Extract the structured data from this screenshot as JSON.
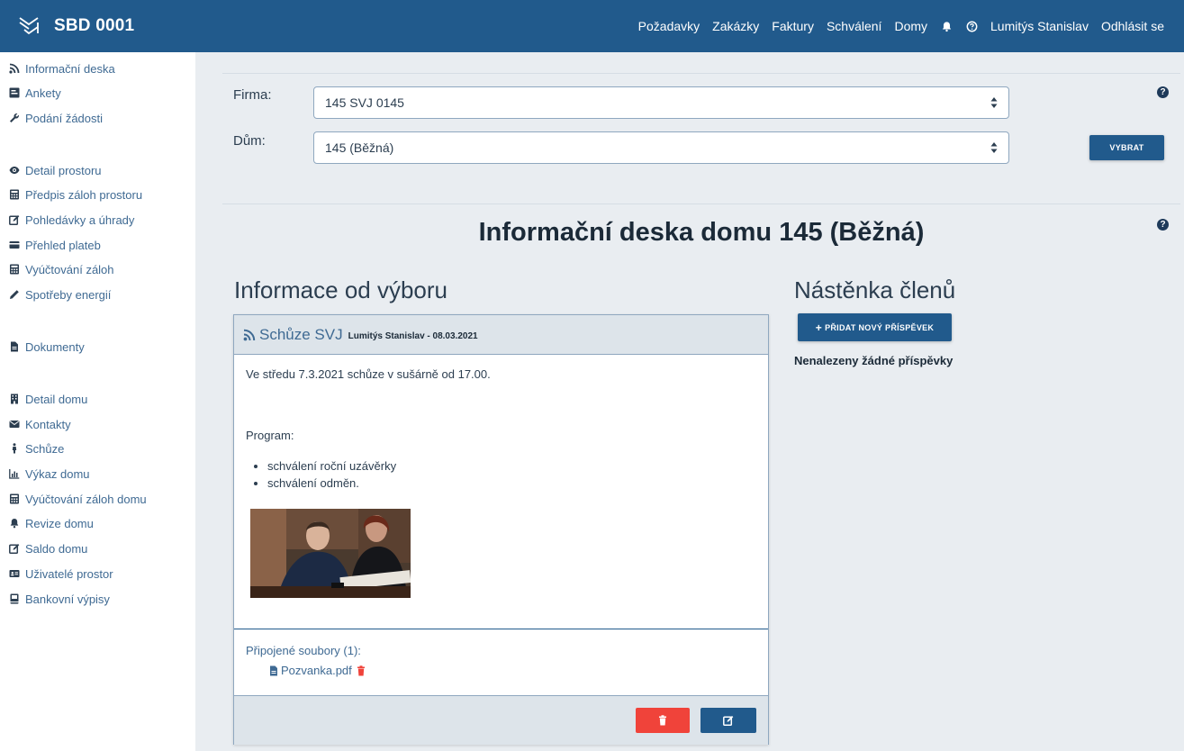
{
  "app": {
    "title": "SBD 0001",
    "nav": {
      "items": [
        "Požadavky",
        "Zakázky",
        "Faktury",
        "Schválení",
        "Domy"
      ],
      "user": "Lumitýs Stanislav",
      "logout": "Odhlásit se"
    }
  },
  "sidebar": {
    "items": [
      {
        "label": "Informační deska",
        "icon": "rss-icon"
      },
      {
        "label": "Ankety",
        "icon": "poll-icon"
      },
      {
        "label": "Podání žádosti",
        "icon": "wrench-icon"
      },
      {
        "label": "Detail prostoru",
        "icon": "eye-icon"
      },
      {
        "label": "Předpis záloh prostoru",
        "icon": "calculator-icon"
      },
      {
        "label": "Pohledávky a úhrady",
        "icon": "edit-icon"
      },
      {
        "label": "Přehled plateb",
        "icon": "credit-card-icon"
      },
      {
        "label": "Vyúčtování záloh",
        "icon": "calculator-icon"
      },
      {
        "label": "Spotřeby energií",
        "icon": "pencil-icon"
      },
      {
        "label": "Dokumenty",
        "icon": "file-icon"
      },
      {
        "label": "Detail domu",
        "icon": "building-icon"
      },
      {
        "label": "Kontakty",
        "icon": "envelope-icon"
      },
      {
        "label": "Schůze",
        "icon": "person-icon"
      },
      {
        "label": "Výkaz domu",
        "icon": "bar-chart-icon"
      },
      {
        "label": "Vyúčtování záloh domu",
        "icon": "calculator-icon"
      },
      {
        "label": "Revize domu",
        "icon": "bell-icon"
      },
      {
        "label": "Saldo domu",
        "icon": "edit-icon"
      },
      {
        "label": "Uživatelé prostor",
        "icon": "id-card-icon"
      },
      {
        "label": "Bankovní výpisy",
        "icon": "book-icon"
      }
    ]
  },
  "filter": {
    "firma_label": "Firma:",
    "firma_value": "145 SVJ 0145",
    "dum_label": "Dům:",
    "dum_value": "145 (Běžná)",
    "select_button": "VYBRAT"
  },
  "main": {
    "title": "Informační deska domu 145 (Běžná)",
    "committee_section": "Informace od výboru",
    "members_section": "Nástěnka členů",
    "add_post_button": "PŘIDAT NOVÝ PŘÍSPĚVEK",
    "no_posts": "Nenalezeny žádné příspěvky",
    "post": {
      "title": "Schůze SVJ",
      "meta": "Lumitýs Stanislav - 08.03.2021",
      "text": "Ve středu 7.3.2021 schůze v sušárně od 17.00.",
      "program_label": "Program:",
      "program_items": [
        "schválení roční uzávěrky",
        "schválení odměn."
      ],
      "files_label": "Připojené soubory (1):",
      "file_name": "Pozvanka.pdf"
    }
  },
  "colors": {
    "primary": "#215a8c",
    "danger": "#f0433a",
    "link": "#3f6a93",
    "panel": "#e9edf1"
  }
}
